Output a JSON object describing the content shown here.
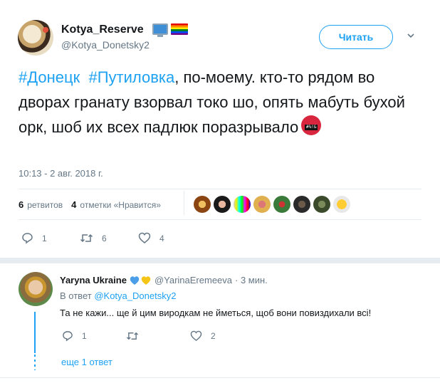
{
  "tweet": {
    "author_name": "Kotya_Reserve",
    "author_handle": "@Kotya_Donetsky2",
    "badge_icons": [
      "computer-icon",
      "rainbow-flag-icon"
    ],
    "follow_label": "Читать",
    "text_parts": {
      "hashtag1": "#Донецк",
      "hashtag2": "#Путиловка",
      "body": ", по-моему. кто-то рядом во дворах гранату взорвал токо шо, опять мабуть бухой орк, шоб их всех падлюк поразрывало"
    },
    "emoji": "face-with-symbols-icon",
    "timestamp": "10:13 - 2 авг. 2018 г.",
    "stats": {
      "retweets_count": "6",
      "retweets_label": "ретвитов",
      "likes_count": "4",
      "likes_label": "отметки «Нравится»"
    },
    "actions": {
      "reply_count": "1",
      "retweet_count": "6",
      "like_count": "4"
    }
  },
  "reply": {
    "author_name": "Yaryna Ukraine",
    "author_handle": "@YarinaEremeeva",
    "time": "· 3 мин.",
    "replying_prefix": "В ответ",
    "replying_to": "@Kotya_Donetsky2",
    "text": "Та не кажи... ще й цим виродкам не йметься, щоб вони повиздихали всі!",
    "actions": {
      "reply_count": "1",
      "retweet_count": "",
      "like_count": "2"
    },
    "more_replies": "еще 1 ответ"
  },
  "colors": {
    "accent": "#1da1f2",
    "muted": "#657786",
    "text": "#14171a",
    "divider": "#e6ecf0"
  }
}
